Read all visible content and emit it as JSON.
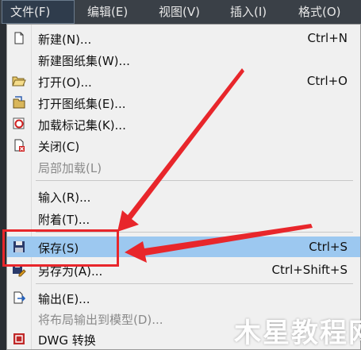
{
  "menubar": {
    "items": [
      {
        "label": "文件(F)"
      },
      {
        "label": "编辑(E)"
      },
      {
        "label": "视图(V)"
      },
      {
        "label": "插入(I)"
      },
      {
        "label": "格式(O)"
      }
    ]
  },
  "menu": {
    "items": [
      {
        "label": "新建(N)...",
        "shortcut": "Ctrl+N",
        "icon": "new-file-icon"
      },
      {
        "label": "新建图纸集(W)...",
        "shortcut": "",
        "icon": ""
      },
      {
        "label": "打开(O)...",
        "shortcut": "Ctrl+O",
        "icon": "open-folder-icon"
      },
      {
        "label": "打开图纸集(E)...",
        "shortcut": "",
        "icon": "open-sheetset-icon"
      },
      {
        "label": "加载标记集(K)...",
        "shortcut": "",
        "icon": "markup-icon"
      },
      {
        "label": "关闭(C)",
        "shortcut": "",
        "icon": "close-file-icon"
      },
      {
        "label": "局部加载(L)",
        "shortcut": "",
        "icon": "",
        "disabled": true
      },
      {
        "label": "输入(R)...",
        "shortcut": "",
        "icon": ""
      },
      {
        "label": "附着(T)...",
        "shortcut": "",
        "icon": ""
      },
      {
        "label": "保存(S)",
        "shortcut": "Ctrl+S",
        "icon": "save-icon",
        "highlighted": true
      },
      {
        "label": "另存为(A)...",
        "shortcut": "Ctrl+Shift+S",
        "icon": "save-as-icon"
      },
      {
        "label": "输出(E)...",
        "shortcut": "",
        "icon": "export-icon"
      },
      {
        "label": "将布局输出到模型(D)...",
        "shortcut": "",
        "icon": "",
        "disabled": true
      },
      {
        "label": "DWG 转换",
        "shortcut": "",
        "icon": "dwg-convert-icon"
      }
    ]
  },
  "watermark": {
    "text": "木星教程网"
  },
  "colors": {
    "highlight": "#9cc8f0",
    "annotation_red": "#e8262b",
    "menubar_bg": "#3a4047"
  }
}
